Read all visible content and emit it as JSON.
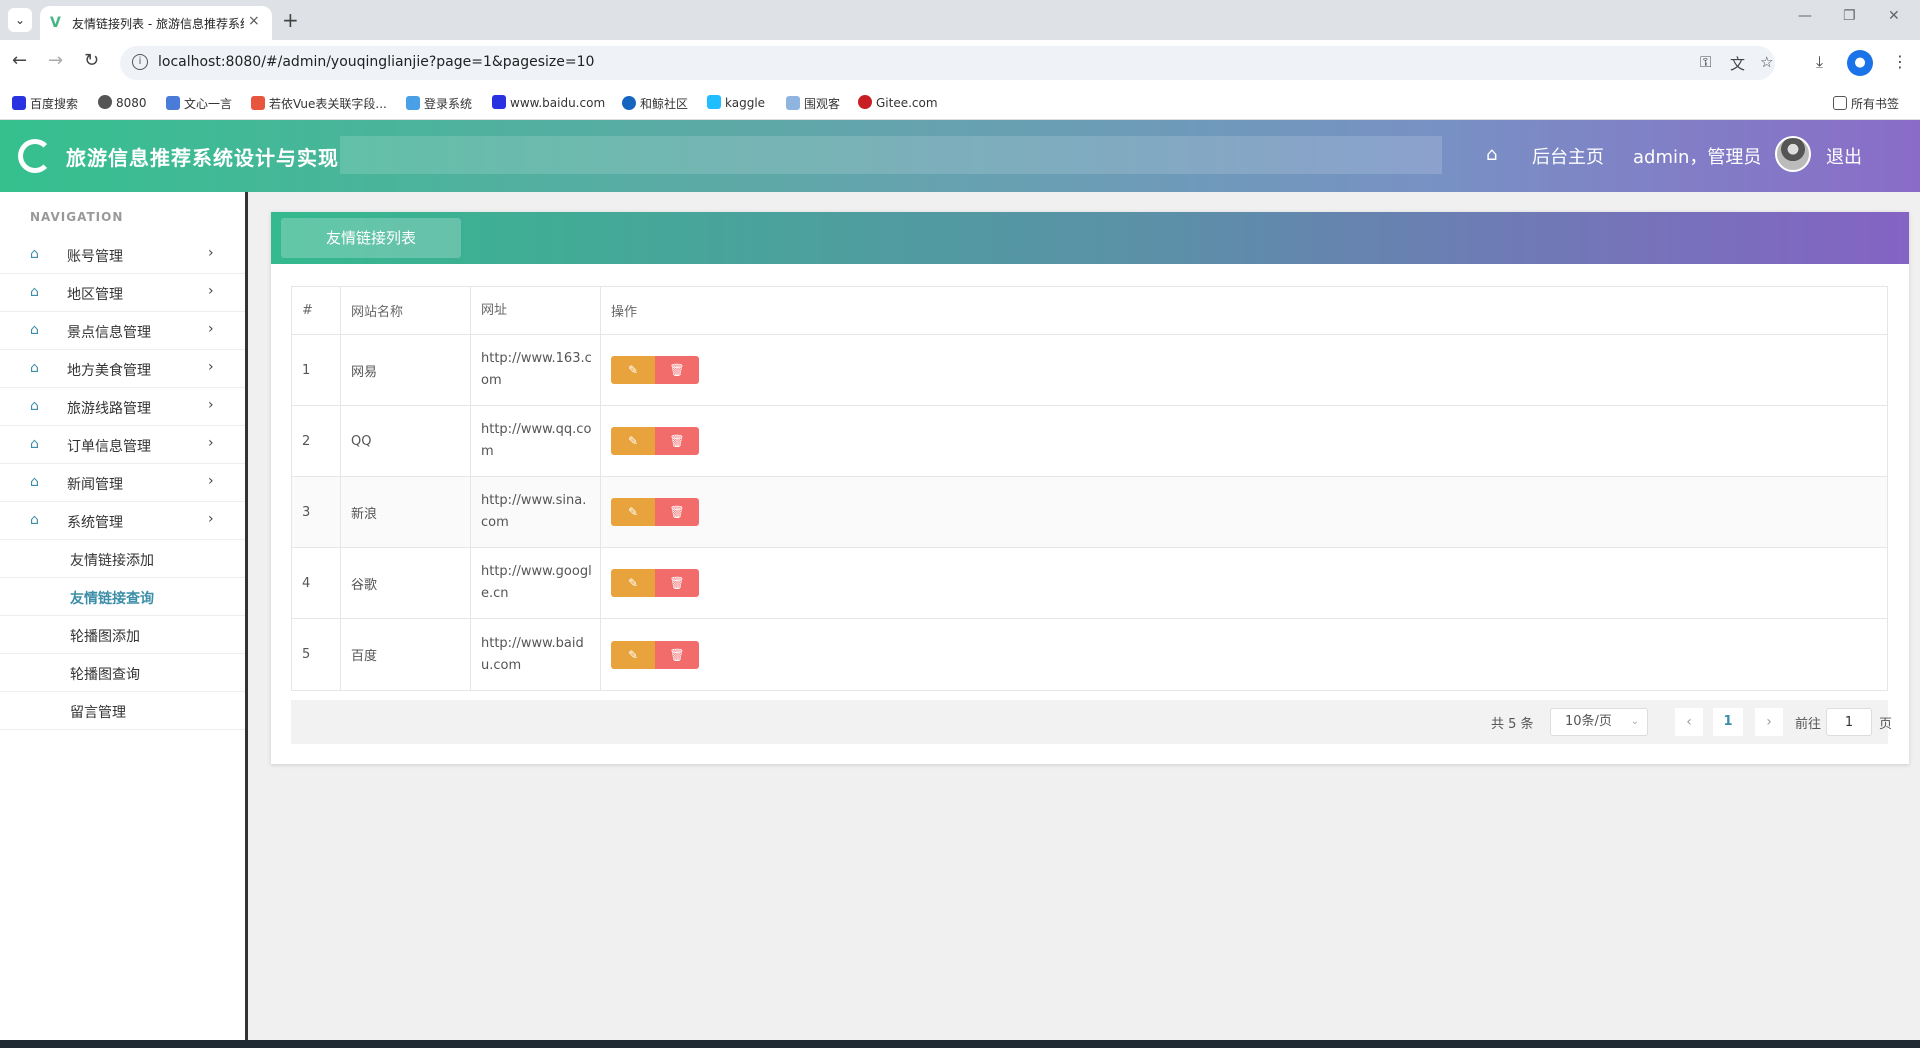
{
  "browser": {
    "tab_title": "友情链接列表 - 旅游信息推荐系统设计与实现",
    "tab_close": "×",
    "new_tab": "+",
    "url": "localhost:8080/#/admin/youqinglianjie?page=1&pagesize=10",
    "bookmarks": [
      "百度搜索",
      "8080",
      "文心一言",
      "若依Vue表关联字段...",
      "登录系统",
      "www.baidu.com",
      "和鲸社区",
      "kaggle",
      "围观客",
      "Gitee.com"
    ],
    "all_bookmarks": "所有书签"
  },
  "header": {
    "app_title": "旅游信息推荐系统设计与实现",
    "home_label": "后台主页",
    "user_label": "admin，管理员",
    "logout_label": "退出"
  },
  "sidebar": {
    "heading": "NAVIGATION",
    "menus": [
      "账号管理",
      "地区管理",
      "景点信息管理",
      "地方美食管理",
      "旅游线路管理",
      "订单信息管理",
      "新闻管理",
      "系统管理"
    ],
    "submenus": [
      "友情链接添加",
      "友情链接查询",
      "轮播图添加",
      "轮播图查询",
      "留言管理"
    ],
    "active_submenu": "友情链接查询"
  },
  "main": {
    "card_title": "友情链接列表",
    "columns": [
      "#",
      "网站名称",
      "网址",
      "操作"
    ],
    "rows": [
      {
        "id": "1",
        "name": "网易",
        "url": "http://www.163.com"
      },
      {
        "id": "2",
        "name": "QQ",
        "url": "http://www.qq.com"
      },
      {
        "id": "3",
        "name": "新浪",
        "url": "http://www.sina.com"
      },
      {
        "id": "4",
        "name": "谷歌",
        "url": "http://www.google.cn"
      },
      {
        "id": "5",
        "name": "百度",
        "url": "http://www.baidu.com"
      }
    ]
  },
  "pagination": {
    "total": "共 5 条",
    "page_size": "10条/页",
    "current_page": "1",
    "goto_label": "前往",
    "goto_value": "1",
    "page_suffix": "页"
  },
  "colors": {
    "accent": "#3d8ea8",
    "edit_button": "#e8a33d",
    "delete_button": "#f26c6c"
  }
}
